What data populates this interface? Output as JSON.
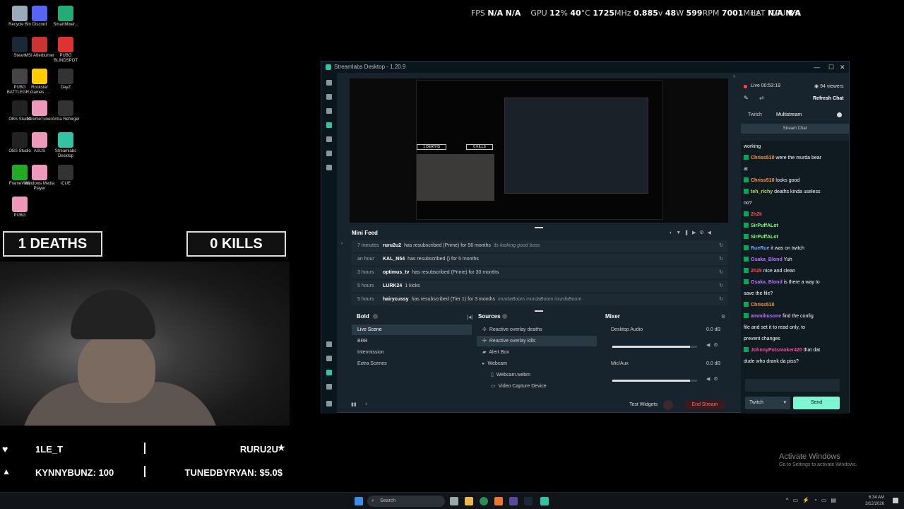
{
  "desktop": {
    "icons": [
      {
        "label": "Recycle Bin",
        "color": "#9ab"
      },
      {
        "label": "Discord",
        "color": "#5865f2"
      },
      {
        "label": "SmartMixer...",
        "color": "#2a7"
      },
      {
        "label": "Steam",
        "color": "#1b2838"
      },
      {
        "label": "MSI Afterburner",
        "color": "#c33"
      },
      {
        "label": "PUBG BLINDSPOT",
        "color": "#d33"
      },
      {
        "label": "PUBG BATTLEGR...",
        "color": "#444"
      },
      {
        "label": "Rockstar Games ...",
        "color": "#fc0"
      },
      {
        "label": "DayZ",
        "color": "#333"
      },
      {
        "label": "OBS Studio",
        "color": "#222"
      },
      {
        "label": "XtremeTuner",
        "color": "#e9b"
      },
      {
        "label": "Arma Reforger",
        "color": "#333"
      },
      {
        "label": "OBS Studio",
        "color": "#222"
      },
      {
        "label": "ASUS",
        "color": "#e9b"
      },
      {
        "label": "Streamlabs Desktop",
        "color": "#31c3a2"
      },
      {
        "label": "FrameView",
        "color": "#2a2"
      },
      {
        "label": "Windows Media Player",
        "color": "#e9b"
      },
      {
        "label": "iCUE",
        "color": "#333"
      },
      {
        "label": "PUBG",
        "color": "#e9b"
      }
    ]
  },
  "hud": {
    "fps_label": "FPS",
    "fps_val1": "N/A",
    "fps_val2": "N/A",
    "gpu_label": "GPU",
    "gpu_load": "12",
    "gpu_load_unit": "%",
    "gpu_temp": "40",
    "gpu_temp_unit": "°C",
    "gpu_clock": "1725",
    "gpu_clock_unit": "MHz",
    "gpu_volt": "0.885",
    "gpu_volt_unit": "v",
    "gpu_power": "48",
    "gpu_power_unit": "W",
    "gpu_fan": "599",
    "gpu_fan_unit": "RPM",
    "gpu_mem": "7001",
    "gpu_mem_unit": "MHz",
    "cpu_label": "CPU",
    "cpu_val": "8",
    "cpu_unit": "%",
    "lat_label": "LAT",
    "lat_val1": "N/A",
    "lat_val2": "N/A"
  },
  "overlay": {
    "deaths": "1 DEATHS",
    "kills": "0 KILLS",
    "follower": "1LE_T",
    "sub": "RURU2U",
    "bits": "KYNNYBUNZ: 100",
    "donation": "TUNEDBYRYAN: $5.0$"
  },
  "streamlabs": {
    "title": "Streamlabs Desktop - 1.20.9",
    "mini_feed_title": "Mini Feed",
    "feed": [
      {
        "time": "7 minutes",
        "user": "ruru2u2",
        "msg": "has resubscribed (Prime) for 56 months",
        "extra": "its looking good boss"
      },
      {
        "time": "an hour",
        "user": "KAL_N54",
        "msg": "has resubscribed () for 5 months",
        "extra": ""
      },
      {
        "time": "3 hours",
        "user": "optimus_tv",
        "msg": "has resubscribed (Prime) for 30 months",
        "extra": ""
      },
      {
        "time": "5 hours",
        "user": "LURK24",
        "msg": "1 kicks",
        "extra": ""
      },
      {
        "time": "5 hours",
        "user": "hairycussy",
        "msg": "has resubscribed (Tier 1) for 3 months",
        "extra": "murdaBoom murdaBoom murdaBoom"
      }
    ],
    "scenes_title": "Bold",
    "scenes": [
      "Live Scene",
      "BRB",
      "Intermission",
      "Extra Scenes"
    ],
    "sources_title": "Sources",
    "sources": [
      "Reactive overlay deaths",
      "Reactive overlay kills",
      "Alert Box",
      "Webcam",
      "Webcam.webm",
      "Video Capture Device"
    ],
    "mixer_title": "Mixer",
    "mixer": [
      {
        "name": "Desktop Audio",
        "db": "0.0 dB",
        "level": 0.92
      },
      {
        "name": "Mic/Aux",
        "db": "0.0 dB",
        "level": 0.92
      }
    ],
    "test_widgets": "Test Widgets",
    "end_stream": "End Stream"
  },
  "chat": {
    "live": "Live 00:53:19",
    "viewers": "94 viewers",
    "refresh": "Refresh Chat",
    "tab_twitch": "Twitch",
    "tab_multi": "Multistream",
    "stream_chat": "Stream Chat",
    "messages": [
      {
        "name": "",
        "color": "#fff",
        "text": "working",
        "badge": false
      },
      {
        "name": "Chriss510",
        "color": "#ff9a3c",
        "text": "were the murda bear",
        "badge": true
      },
      {
        "name": "",
        "color": "#fff",
        "text": "at",
        "badge": false
      },
      {
        "name": "Chriss510",
        "color": "#ff9a3c",
        "text": "looks good",
        "badge": true
      },
      {
        "name": "teh_richy",
        "color": "#b0e060",
        "text": "deaths kinda useless",
        "badge": true
      },
      {
        "name": "",
        "color": "#fff",
        "text": "no?",
        "badge": false
      },
      {
        "name": "2h2k",
        "color": "#ff4a4a",
        "text": "",
        "badge": true
      },
      {
        "name": "SirPuffALot",
        "color": "#7fff7f",
        "text": "",
        "badge": true
      },
      {
        "name": "SirPuffALot",
        "color": "#7fff7f",
        "text": "",
        "badge": true
      },
      {
        "name": "RueRue",
        "color": "#66aaff",
        "text": "it was on twitch",
        "badge": true
      },
      {
        "name": "Osaka_Blond",
        "color": "#c070ff",
        "text": "Yuh",
        "badge": true
      },
      {
        "name": "2h2k",
        "color": "#ff4a4a",
        "text": "nice and clean",
        "badge": true
      },
      {
        "name": "Osaka_Blond",
        "color": "#c070ff",
        "text": "is there a way to",
        "badge": true
      },
      {
        "name": "",
        "color": "#fff",
        "text": "save the file?",
        "badge": false
      },
      {
        "name": "Chriss510",
        "color": "#ff9a3c",
        "text": "",
        "badge": true
      },
      {
        "name": "ammibusone",
        "color": "#c070ff",
        "text": "find the config",
        "badge": true
      },
      {
        "name": "",
        "color": "#fff",
        "text": "file and set it to read only, to",
        "badge": false
      },
      {
        "name": "",
        "color": "#fff",
        "text": "prevent changes",
        "badge": false
      },
      {
        "name": "JohnnyPotsmoker420",
        "color": "#ff4a9a",
        "text": "that dat",
        "badge": true
      },
      {
        "name": "",
        "color": "#fff",
        "text": "dude who drank da piss?",
        "badge": false
      }
    ],
    "select": "Twitch",
    "send": "Send"
  },
  "activate": {
    "title": "Activate Windows",
    "sub": "Go to Settings to activate Windows."
  },
  "taskbar": {
    "search": "Search",
    "time": "6:34 AM",
    "date": "3/12/2026"
  }
}
